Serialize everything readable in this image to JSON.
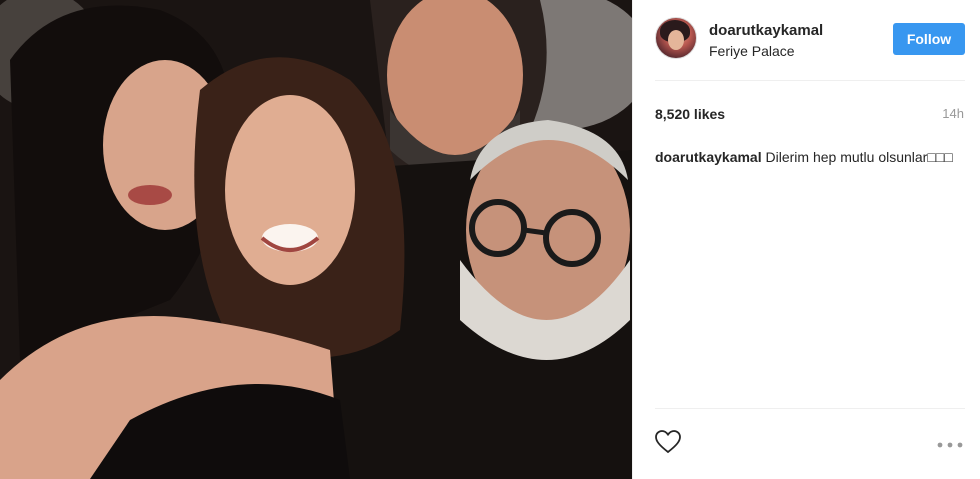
{
  "post": {
    "username": "doarutkaykamal",
    "location": "Feriye Palace",
    "follow_label": "Follow",
    "likes": "8,520 likes",
    "time": "14h",
    "caption_user": "doarutkaykamal",
    "caption_text": " Dilerim hep mutlu olsunlar□□□"
  },
  "icons": {
    "like": "heart-icon",
    "more": "more-options-icon"
  },
  "colors": {
    "follow_button": "#3897f0",
    "timestamp": "#999999"
  }
}
